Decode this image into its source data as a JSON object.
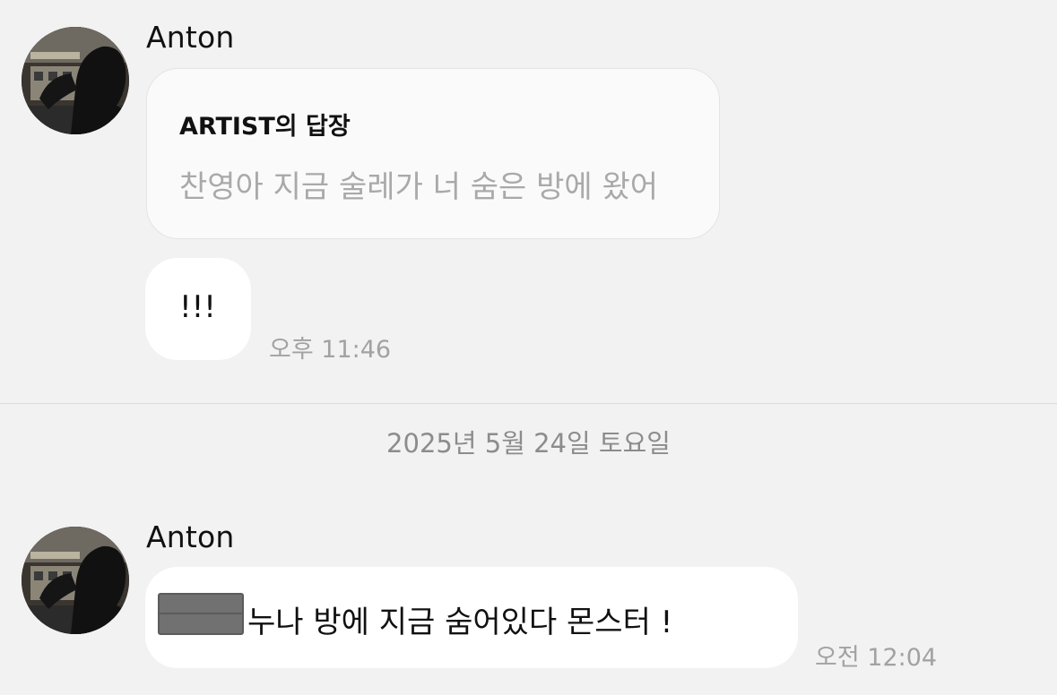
{
  "messages": [
    {
      "sender": "Anton",
      "reply": {
        "title": "ARTIST의 답장",
        "quote": "찬영아 지금 술레가 너 숨은 방에 왔어"
      },
      "text": "!!!",
      "time": "오후 11:46"
    }
  ],
  "date_separator": "2025년 5월 24일 토요일",
  "messages_after": [
    {
      "sender": "Anton",
      "text": "누나 방에 지금 숨어있다 몬스터 !",
      "time": "오전 12:04",
      "redacted": true
    }
  ],
  "icons": {
    "avatar": "profile-photo"
  },
  "colors": {
    "background": "#f2f2f2",
    "bubble": "#ffffff",
    "reply_card": "#fafafa",
    "timestamp": "#a2a2a2",
    "quote_text": "#a9a9a9"
  }
}
